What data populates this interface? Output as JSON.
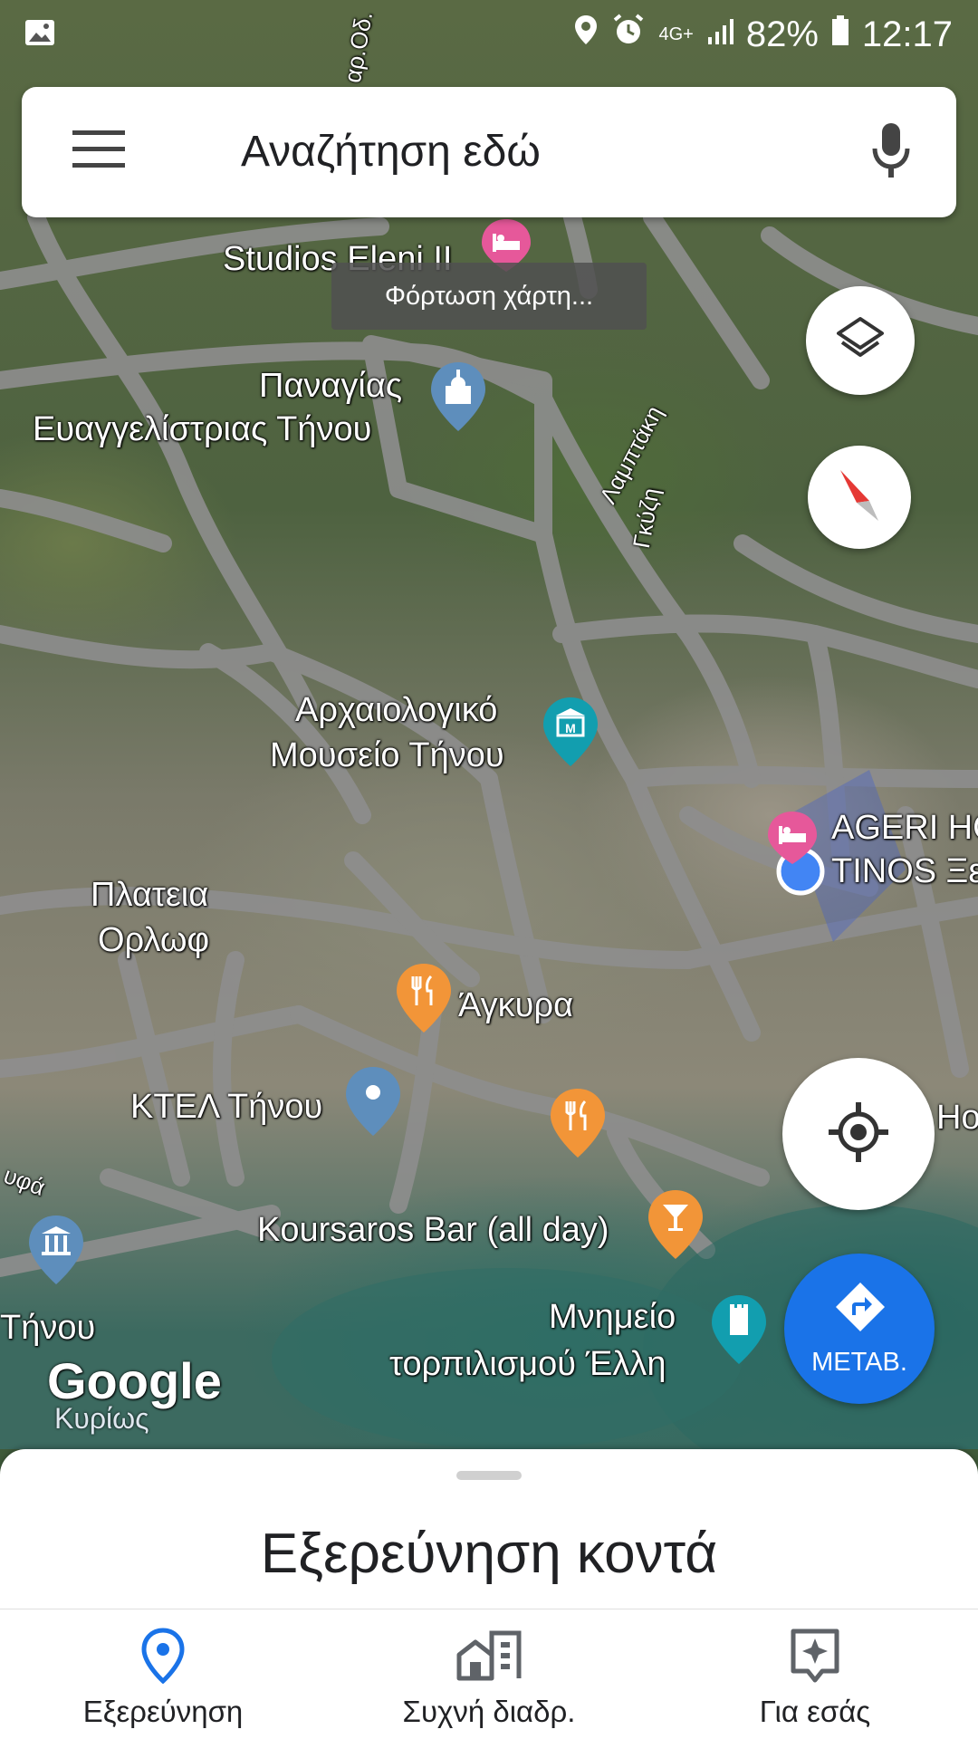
{
  "status_bar": {
    "battery": "82%",
    "time": "12:17",
    "network": "4G+"
  },
  "search": {
    "placeholder": "Αναζήτηση εδώ",
    "menu_icon": "hamburger-menu-icon",
    "mic_icon": "microphone-icon"
  },
  "toast": {
    "text": "Φόρτωση χάρτη..."
  },
  "map": {
    "labels": {
      "studios": "Studios Eleni II",
      "panagia_1": "Παναγίας",
      "panagia_2": "Ευαγγελίστριας Τήνου",
      "street_lamptaki": "Λαμπτάκη",
      "street_gyzi": "Γκύζη",
      "street_top": "αρ.Οδ.",
      "museum_1": "Αρχαιολογικό",
      "museum_2": "Μουσείο Τήνου",
      "ageri_1": "AGERI HO",
      "ageri_2": "TINOS Ξε",
      "plateia_1": "Πλατεια",
      "plateia_2": "Ορλωφ",
      "agkyra": "Άγκυρα",
      "ktel": "ΚΤΕΛ Τήνου",
      "hotel_partial": "Hot",
      "street_left": "υφά",
      "koursaros": "Koursaros Bar (all day)",
      "tinou_partial": "Τήνου",
      "mnimeio_1": "Μνημείο",
      "mnimeio_2": "τορπιλισμού Έλλη"
    },
    "google_logo": "Google",
    "map_mode": "Κυρίως"
  },
  "fabs": {
    "layers_icon": "layers-icon",
    "compass_icon": "compass-icon",
    "location_icon": "my-location-icon",
    "directions_label": "ΜΕΤΑΒ."
  },
  "sheet": {
    "title": "Εξερεύνηση κοντά"
  },
  "bottom_nav": {
    "explore": "Εξερεύνηση",
    "commute": "Συχνή διαδρ.",
    "for_you": "Για εσάς"
  }
}
